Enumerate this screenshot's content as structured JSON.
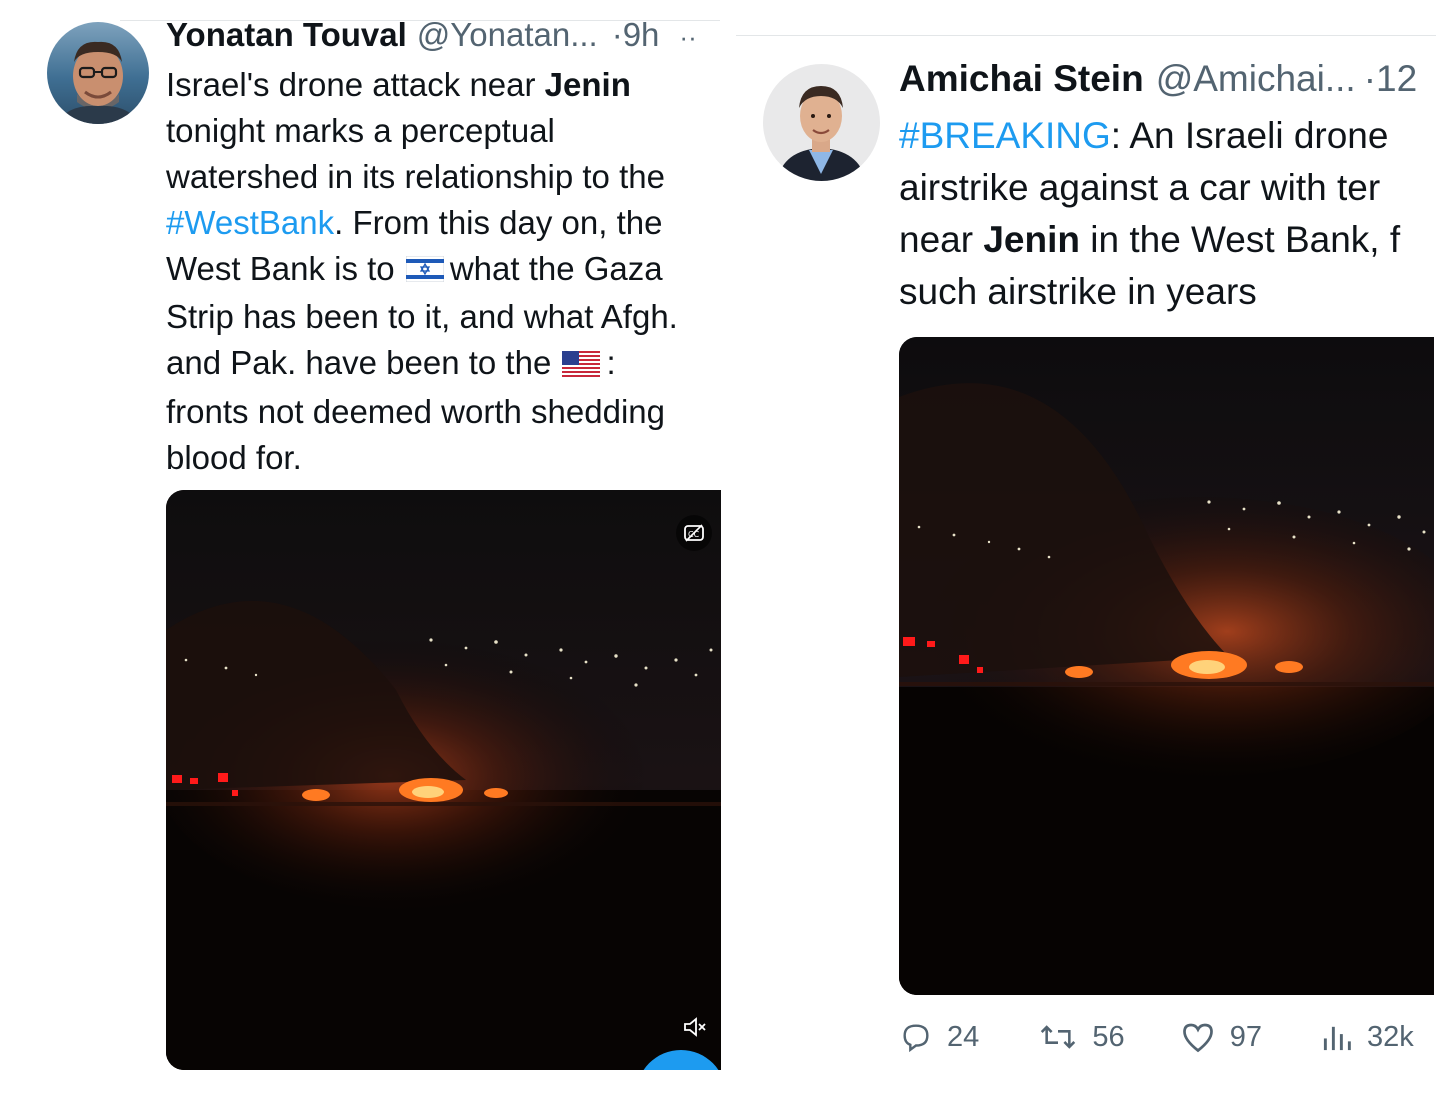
{
  "left_tweet": {
    "author_name": "Yonatan Touval",
    "author_handle": "@Yonatan...",
    "time": "·9h",
    "more": "··",
    "lines": [
      [
        {
          "t": "Israel's drone attack near "
        },
        {
          "t": "Jenin",
          "b": true
        }
      ],
      [
        {
          "t": "tonight marks a perceptual"
        }
      ],
      [
        {
          "t": "watershed in its relationship to the"
        }
      ],
      [
        {
          "t": "#WestBank",
          "tag": true
        },
        {
          "t": ". From this day on, the"
        }
      ],
      [
        {
          "t": "West Bank is to "
        },
        {
          "flag": "israel-flag"
        },
        {
          "t": "what the Gaza"
        }
      ],
      [
        {
          "t": "Strip has been to it, and what Afgh."
        }
      ],
      [
        {
          "t": "and Pak. have been to the "
        },
        {
          "flag": "us-flag"
        },
        {
          "t": ":"
        }
      ],
      [
        {
          "t": "fronts not deemed worth shedding"
        }
      ],
      [
        {
          "t": "blood for."
        }
      ]
    ],
    "media_controls": [
      "captions-icon",
      "mute-icon"
    ]
  },
  "right_tweet": {
    "author_name": "Amichai Stein",
    "author_handle": "@Amichai...",
    "time": "·12",
    "lines": [
      [
        {
          "t": "#BREAKING",
          "tag": true
        },
        {
          "t": ": An Israeli drone"
        }
      ],
      [
        {
          "t": "airstrike against a car with ter"
        }
      ],
      [
        {
          "t": "near "
        },
        {
          "t": "Jenin",
          "b": true
        },
        {
          "t": " in the West Bank, f"
        }
      ],
      [
        {
          "t": "such airstrike in years"
        }
      ]
    ],
    "actions": {
      "replies": "24",
      "retweets": "56",
      "likes": "97",
      "views": "32k"
    }
  },
  "colors": {
    "link_blue": "#1d9bf0",
    "text": "#0f1419",
    "secondary": "#536471"
  }
}
